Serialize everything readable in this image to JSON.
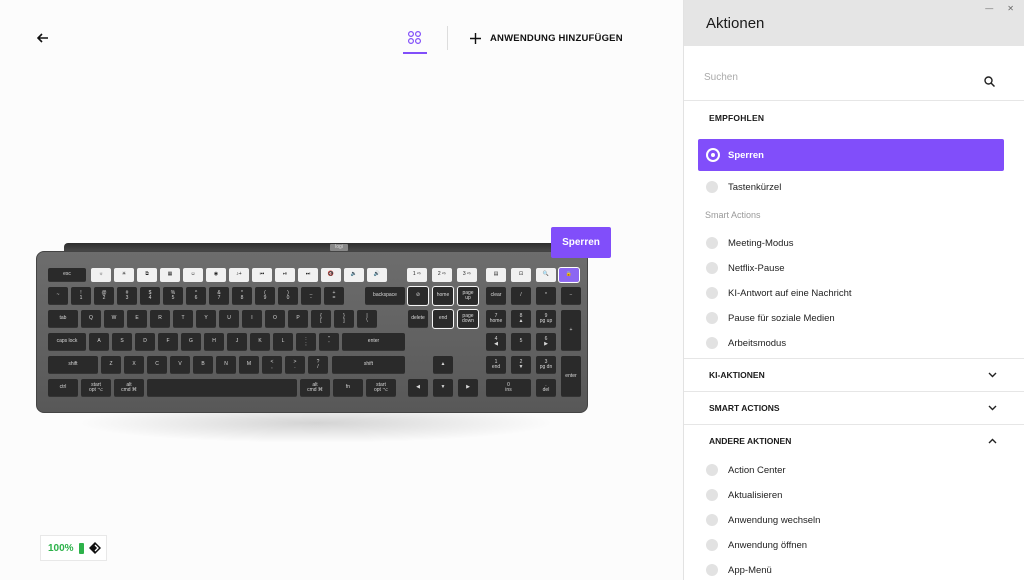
{
  "header": {
    "add_app_label": "ANWENDUNG HINZUFÜGEN"
  },
  "tooltip": "Sperren",
  "battery": {
    "percent_label": "100%"
  },
  "panel": {
    "title": "Aktionen",
    "search_placeholder": "Suchen",
    "recommended_label": "EMPFOHLEN",
    "recommended": [
      {
        "label": "Sperren",
        "selected": true
      },
      {
        "label": "Tastenkürzel",
        "selected": false
      }
    ],
    "smart_actions_sub": "Smart Actions",
    "smart_items": [
      "Meeting-Modus",
      "Netflix-Pause",
      "KI-Antwort auf eine Nachricht",
      "Pause für soziale Medien",
      "Arbeitsmodus"
    ],
    "sections": [
      {
        "label": "KI-AKTIONEN",
        "expanded": false
      },
      {
        "label": "SMART ACTIONS",
        "expanded": false
      },
      {
        "label": "ANDERE AKTIONEN",
        "expanded": true
      }
    ],
    "other_items": [
      "Action Center",
      "Aktualisieren",
      "Anwendung wechseln",
      "Anwendung öffnen",
      "App-Menü"
    ]
  },
  "keyboard": {
    "row_num": [
      "~",
      "!\n1",
      "@\n2",
      "#\n3",
      "$\n4",
      "%\n5",
      "^\n6",
      "&\n7",
      "*\n8",
      "(\n9",
      ")\n0",
      "_\n-",
      "+\n="
    ],
    "row_q": [
      "Q",
      "W",
      "E",
      "R",
      "T",
      "Y",
      "U",
      "I",
      "O",
      "P",
      "{\n[",
      "}\n]",
      "|\n\\"
    ],
    "row_a": [
      "A",
      "S",
      "D",
      "F",
      "G",
      "H",
      "J",
      "K",
      "L",
      ":\n;",
      "\"\n'"
    ],
    "row_z": [
      "Z",
      "X",
      "C",
      "V",
      "B",
      "N",
      "M",
      "<\n,",
      ">\n.",
      "?\n/"
    ],
    "labels": {
      "esc": "esc",
      "tab": "tab",
      "caps": "caps lock",
      "shift": "shift",
      "ctrl": "ctrl",
      "start": "start\nopt ⌥",
      "alt": "alt\ncmd ⌘",
      "altr": "alt\ncmd ⌘",
      "fn": "fn",
      "optr": "start\nopt ⌥",
      "backspace": "backspace",
      "enter": "enter",
      "shiftr": "shift",
      "home": "home",
      "pgup": "page\nup",
      "delete": "delete",
      "end": "end",
      "pgdn": "page\ndown",
      "clear": "clear",
      "numenter": "enter",
      "n7": "7\nhome",
      "n8": "8\n▲",
      "n9": "9\npg up",
      "n4": "4\n◀",
      "n5": "5",
      "n6": "6\n▶",
      "n1": "1\nend",
      "n2": "2\n▼",
      "n3": "3\npg dn",
      "n0": "0\nins",
      "ndot": ".\ndel",
      "div": "/",
      "mul": "*",
      "minus": "−",
      "plus": "+"
    }
  }
}
